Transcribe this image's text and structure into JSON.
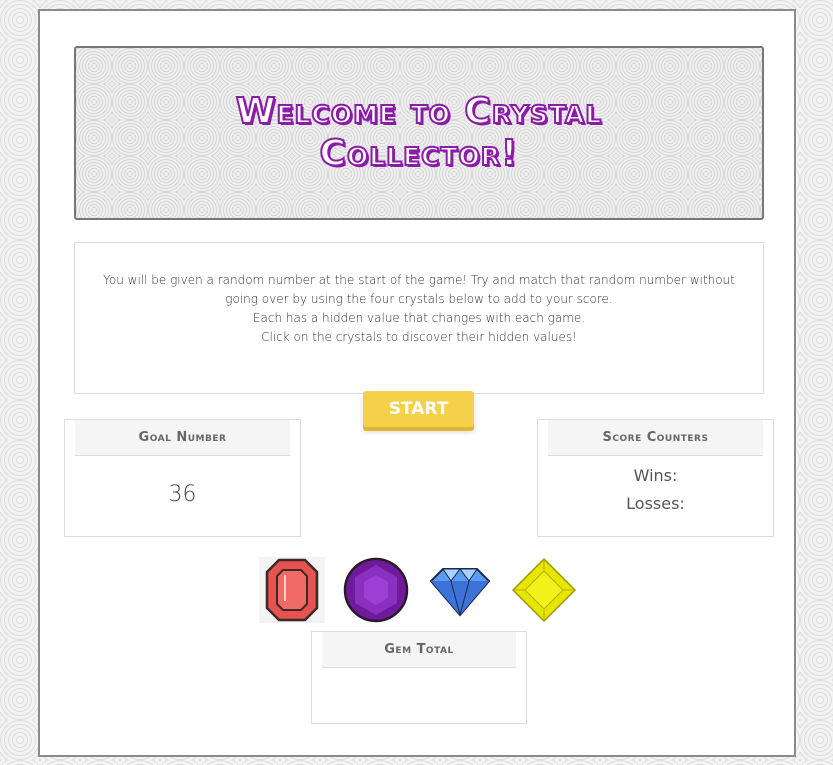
{
  "header": {
    "title": "Welcome to Crystal Collector!"
  },
  "instructions": {
    "line1": "You will be given a random number at the start of the game! Try and match that random number without going over by using the four crystals below to add to your score.",
    "line2": "Each has a hidden value that changes with each game.",
    "line3": "Click on the crystals to discover their hidden values!"
  },
  "start_button": {
    "label": "START"
  },
  "goal_panel": {
    "title": "Goal Number",
    "value": "36"
  },
  "score_panel": {
    "title": "Score Counters",
    "wins_label": "Wins:",
    "losses_label": "Losses:"
  },
  "gems": [
    {
      "name": "red gem",
      "icon": "red-octagon-gem-icon",
      "color": "#e8524f"
    },
    {
      "name": "purple gem",
      "icon": "purple-round-gem-icon",
      "color": "#7a1aa8"
    },
    {
      "name": "blue gem",
      "icon": "blue-diamond-icon",
      "color": "#3b7ae8"
    },
    {
      "name": "yellow gem",
      "icon": "yellow-square-gem-icon",
      "color": "#e6e600"
    }
  ],
  "gem_total_panel": {
    "title": "Gem Total",
    "value": ""
  },
  "colors": {
    "title_accent": "#8a1ca6",
    "start_button": "#f5d04b",
    "panel_header_bg": "#f5f5f5"
  }
}
